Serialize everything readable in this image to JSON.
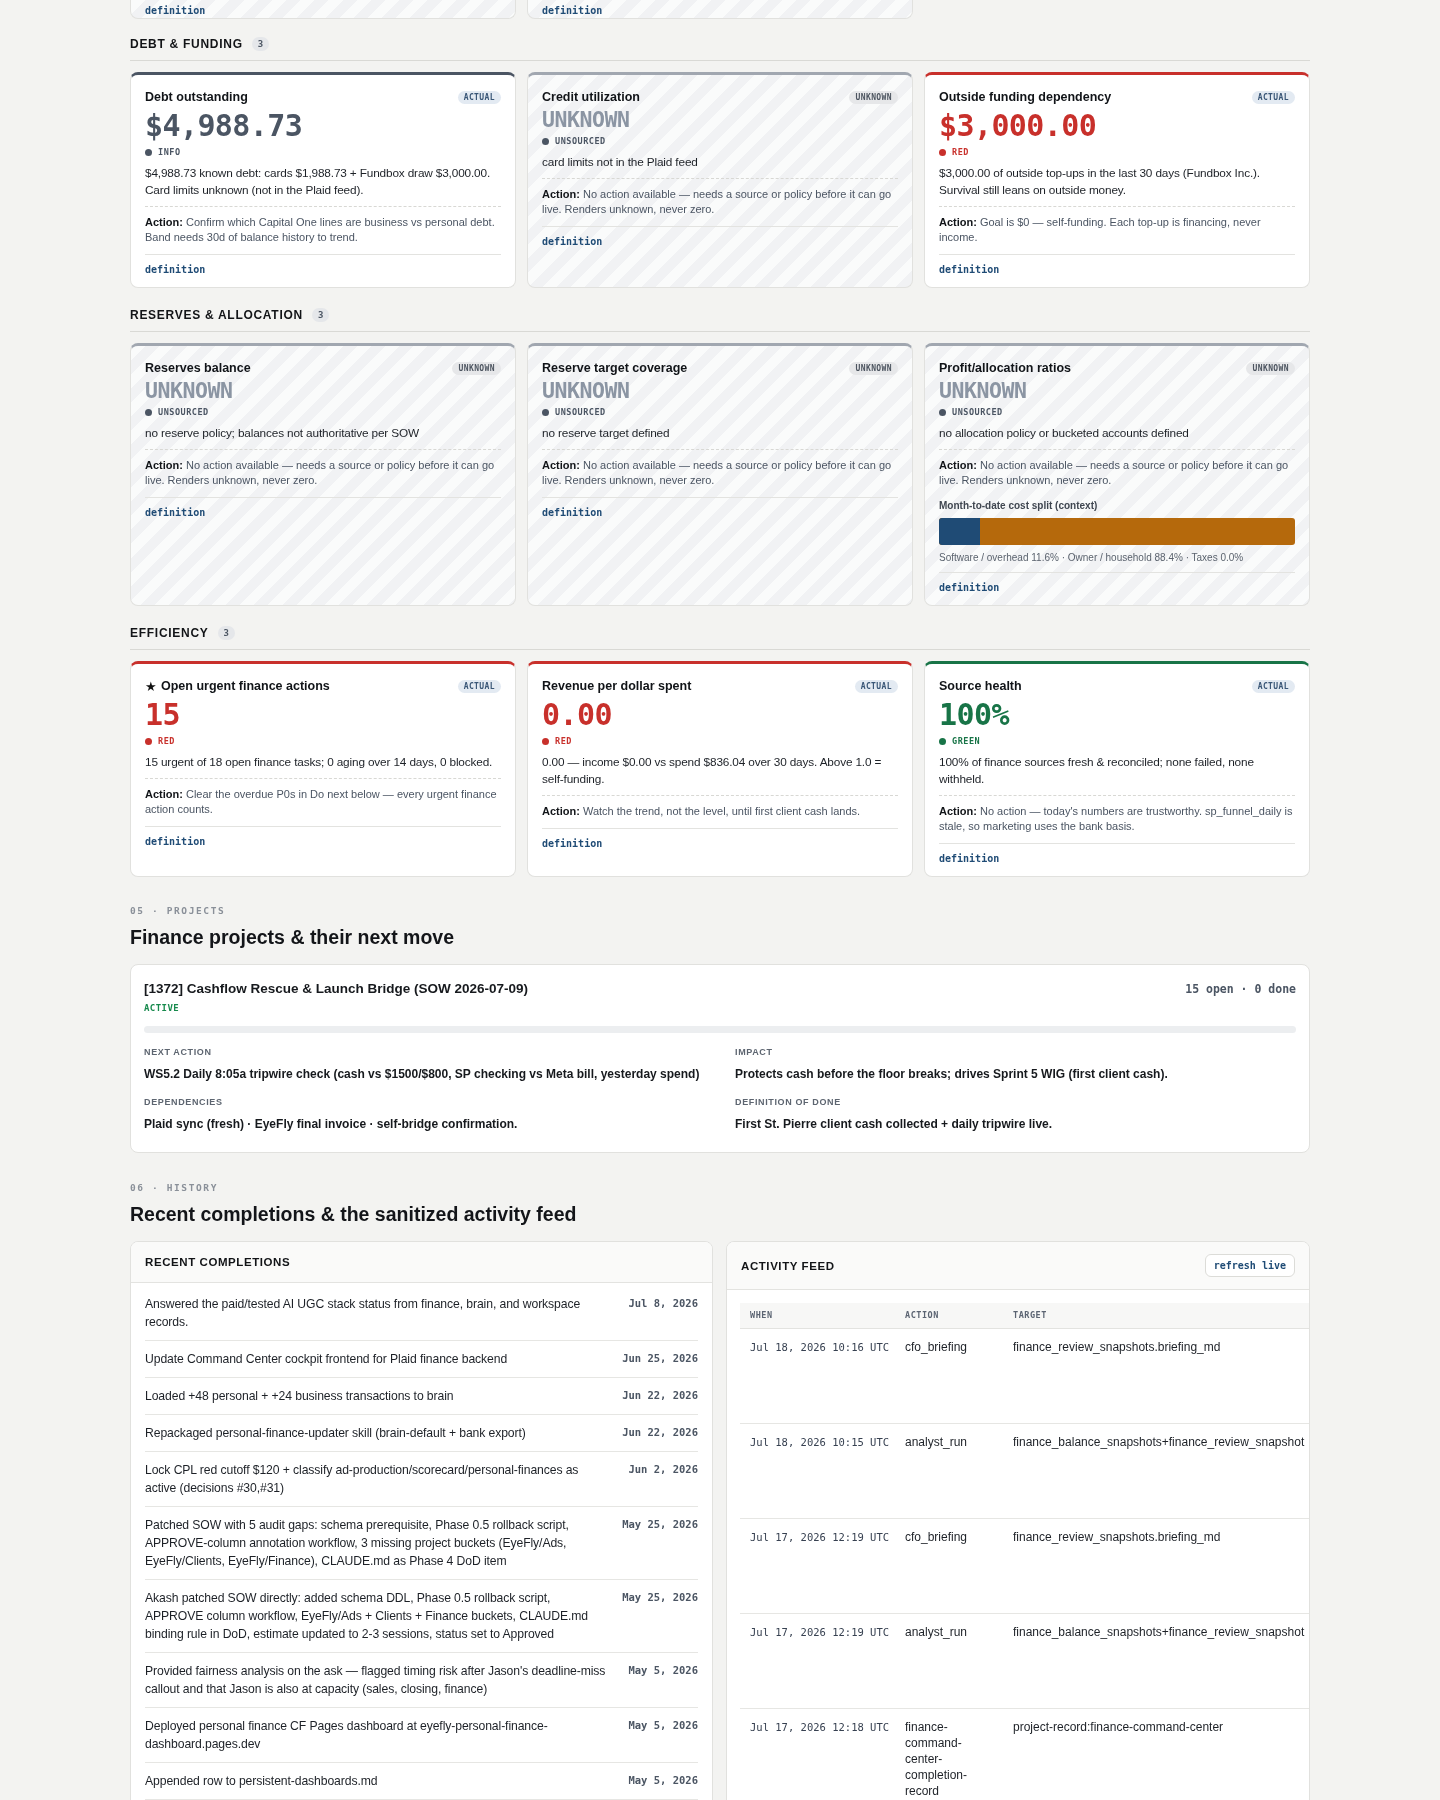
{
  "top_cards": [
    {
      "kind": "unknown",
      "link": "definition"
    },
    {
      "kind": "unknown",
      "link": "definition"
    }
  ],
  "sections": [
    {
      "title": "DEBT & FUNDING",
      "count": "3",
      "cards": [
        {
          "title": "Debt outstanding",
          "kind": "actual",
          "badge": "ACTUAL",
          "value": "$4,988.73",
          "color": "#4b5563",
          "status": "INFO",
          "description": "$4,988.73 known debt: cards $1,988.73 + Fundbox draw $3,000.00. Card limits unknown (not in the Plaid feed).",
          "action": "**Action:** Confirm which Capital One lines are business vs personal debt. Band needs 30d of balance history to trend.",
          "link": "definition"
        },
        {
          "title": "Credit utilization",
          "kind": "unknown",
          "badge": "UNKNOWN",
          "value": "UNKNOWN",
          "color": "#4b5563",
          "status": "UNSOURCED",
          "description": "card limits not in the Plaid feed",
          "action": "**Action:** No action available — needs a source or policy before it can go live. Renders unknown, never zero.",
          "link": "definition"
        },
        {
          "title": "Outside funding dependency",
          "kind": "actual",
          "badge": "ACTUAL",
          "value": "$3,000.00",
          "color": "#c8302b",
          "status": "RED",
          "description": "$3,000.00 of outside top-ups in the last 30 days (Fundbox Inc.). Survival still leans on outside money.",
          "action": "**Action:** Goal is $0 — self-funding. Each top-up is financing, never income.",
          "link": "definition"
        }
      ]
    },
    {
      "title": "RESERVES & ALLOCATION",
      "count": "3",
      "cards": [
        {
          "title": "Reserves balance",
          "kind": "unknown",
          "badge": "UNKNOWN",
          "value": "UNKNOWN",
          "color": "#4b5563",
          "status": "UNSOURCED",
          "description": "no reserve policy; balances not authoritative per SOW",
          "action": "**Action:** No action available — needs a source or policy before it can go live. Renders unknown, never zero.",
          "link": "definition"
        },
        {
          "title": "Reserve target coverage",
          "kind": "unknown",
          "badge": "UNKNOWN",
          "value": "UNKNOWN",
          "color": "#4b5563",
          "status": "UNSOURCED",
          "description": "no reserve target defined",
          "action": "**Action:** No action available — needs a source or policy before it can go live. Renders unknown, never zero.",
          "link": "definition"
        },
        {
          "title": "Profit/allocation ratios",
          "kind": "unknown",
          "badge": "UNKNOWN",
          "value": "UNKNOWN",
          "color": "#4b5563",
          "status": "UNSOURCED",
          "description": "no allocation policy or bucketed accounts defined",
          "action": "**Action:** No action available — needs a source or policy before it can go live. Renders unknown, never zero.",
          "split": {
            "label": "Month-to-date cost split (context)",
            "level": 0.116,
            "segments": [
              {
                "color": "#1f4b75"
              },
              {
                "color": "#b5690c"
              }
            ],
            "legend": "Software / overhead 11.6% · Owner / household 88.4% · Taxes 0.0%"
          },
          "link": "definition"
        }
      ]
    },
    {
      "title": "EFFICIENCY",
      "count": "3",
      "cards": [
        {
          "marker": "★",
          "title": "Open urgent finance actions",
          "kind": "actual",
          "badge": "ACTUAL",
          "value": "15",
          "color": "#c8302b",
          "status": "RED",
          "description": "15 urgent of 18 open finance tasks; 0 aging over 14 days, 0 blocked.",
          "action": "**Action:** Clear the overdue P0s in Do next below — every urgent finance action counts.",
          "link": "definition"
        },
        {
          "title": "Revenue per dollar spent",
          "kind": "actual",
          "badge": "ACTUAL",
          "value": "0.00",
          "color": "#c8302b",
          "status": "RED",
          "description": "0.00 — income $0.00 vs spend $836.04 over 30 days. Above 1.0 = self-funding.",
          "action": "**Action:** Watch the trend, not the level, until first client cash lands.",
          "link": "definition"
        },
        {
          "title": "Source health",
          "kind": "actual",
          "badge": "ACTUAL",
          "value": "100%",
          "color": "#187447",
          "status": "GREEN",
          "description": "100% of finance sources fresh & reconciled; none failed, none withheld.",
          "action": "**Action:** No action — today's numbers are trustworthy. sp_funnel_daily is stale, so marketing uses the bank basis.",
          "link": "definition"
        }
      ]
    }
  ],
  "projects": {
    "eyebrow": "05 · PROJECTS",
    "heading": "Finance projects & their next move",
    "cards": [
      {
        "title": "[1372] Cashflow Rescue & Launch Bridge (SOW 2026-07-09)",
        "status": "ACTIVE",
        "counts": "15 open · 0 done",
        "fields": [
          {
            "label": "NEXT ACTION",
            "value": "WS5.2 Daily 8:05a tripwire check (cash vs $1500/$800, SP checking vs Meta bill, yesterday spend)"
          },
          {
            "label": "IMPACT",
            "value": "Protects cash before the floor breaks; drives Sprint 5 WIG (first client cash)."
          },
          {
            "label": "DEPENDENCIES",
            "value": "Plaid sync (fresh) · EyeFly final invoice · self-bridge confirmation."
          },
          {
            "label": "DEFINITION OF DONE",
            "value": "First St. Pierre client cash collected + daily tripwire live."
          }
        ]
      }
    ]
  },
  "history": {
    "eyebrow": "06 · HISTORY",
    "heading": "Recent completions & the sanitized activity feed",
    "completions": {
      "title": "RECENT COMPLETIONS",
      "items": [
        {
          "text": "Answered the paid/tested AI UGC stack status from finance, brain, and workspace records.",
          "date": "Jul 8, 2026"
        },
        {
          "text": "Update Command Center cockpit frontend for Plaid finance backend",
          "date": "Jun 25, 2026"
        },
        {
          "text": "Loaded +48 personal + +24 business transactions to brain",
          "date": "Jun 22, 2026"
        },
        {
          "text": "Repackaged personal-finance-updater skill (brain-default + bank export)",
          "date": "Jun 22, 2026"
        },
        {
          "text": "Lock CPL red cutoff $120 + classify ad-production/scorecard/personal-finances as active (decisions #30,#31)",
          "date": "Jun 2, 2026"
        },
        {
          "text": "Patched SOW with 5 audit gaps: schema prerequisite, Phase 0.5 rollback script, APPROVE-column annotation workflow, 3 missing project buckets (EyeFly/Ads, EyeFly/Clients, EyeFly/Finance), CLAUDE.md as Phase 4 DoD item",
          "date": "May 25, 2026"
        },
        {
          "text": "Akash patched SOW directly: added schema DDL, Phase 0.5 rollback script, APPROVE column workflow, EyeFly/Ads + Clients + Finance buckets, CLAUDE.md binding rule in DoD, estimate updated to 2-3 sessions, status set to Approved",
          "date": "May 25, 2026"
        },
        {
          "text": "Provided fairness analysis on the ask — flagged timing risk after Jason's deadline-miss callout and that Jason is also at capacity (sales, closing, finance)",
          "date": "May 5, 2026"
        },
        {
          "text": "Deployed personal finance CF Pages dashboard at eyefly-personal-finance-dashboard.pages.dev",
          "date": "May 5, 2026"
        },
        {
          "text": "Appended row to persistent-dashboards.md",
          "date": "May 5, 2026"
        }
      ]
    },
    "activity": {
      "title": "ACTIVITY FEED",
      "button": "refresh live",
      "columns": [
        "WHEN",
        "ACTION",
        "TARGET"
      ],
      "rows": [
        {
          "when": "Jul 18, 2026 10:16 UTC",
          "action": "cfo_briefing",
          "target": "finance_review_snapshots.briefing_md"
        },
        {
          "when": "Jul 18, 2026 10:15 UTC",
          "action": "analyst_run",
          "target": "finance_balance_snapshots+finance_review_snapshot"
        },
        {
          "when": "Jul 17, 2026 12:19 UTC",
          "action": "cfo_briefing",
          "target": "finance_review_snapshots.briefing_md"
        },
        {
          "when": "Jul 17, 2026 12:19 UTC",
          "action": "analyst_run",
          "target": "finance_balance_snapshots+finance_review_snapshot"
        },
        {
          "when": "Jul 17, 2026 12:18 UTC",
          "action": "finance-command-center-completion-record",
          "target": "project-record:finance-command-center"
        }
      ]
    }
  }
}
